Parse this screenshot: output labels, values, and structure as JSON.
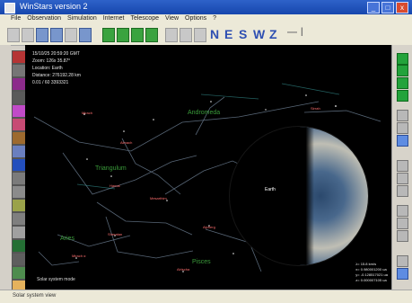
{
  "window": {
    "title": "WinStars version 2",
    "minimize_label": "_",
    "maximize_label": "□",
    "close_label": "x"
  },
  "menu": {
    "items": [
      "File",
      "Observation",
      "Simulation",
      "Internet",
      "Telescope",
      "View",
      "Options",
      "?"
    ]
  },
  "toolbar": {
    "directions": [
      "N",
      "E",
      "S",
      "W",
      "Z"
    ],
    "zoom_out_label": "—",
    "zoom_reset_label": "|"
  },
  "overlay": {
    "datetime": "15/10/25  20:59:20 GMT",
    "zoom": "Zoom: 126x 35.87°",
    "location": "Location: Earth",
    "distance": "Distance: 276192.28 km",
    "elevation": "0.01 / 60 3393321"
  },
  "constellations": [
    "Andromeda",
    "Triangulum",
    "Aries",
    "Pisces"
  ],
  "stars": [
    "Mirach",
    "Almach",
    "Hamal",
    "Sheratan",
    "Mesarthim",
    "Alpherg",
    "Sirrah",
    "Alrischa",
    "Mirach α"
  ],
  "earth_label": "Earth",
  "status": {
    "left_note": "Solar system mode",
    "coords": [
      "λ=  15.8 km/s",
      "x=  0.980001200 ua",
      "y=  -0.128517021 ua",
      "z=  0.000007105 ua"
    ]
  },
  "statusbar": {
    "text": "Solar system view"
  },
  "colors": {
    "titlebar": "#2e62c9",
    "sky": "#000000",
    "constellation": "#3a9b3a",
    "star_label": "#ff6f6f",
    "toolbar_green": "#3aa33f",
    "direction_blue": "#2e4fb2"
  },
  "icons": {
    "app": "app-window-icon",
    "star_tool": "star-tool-icon"
  }
}
